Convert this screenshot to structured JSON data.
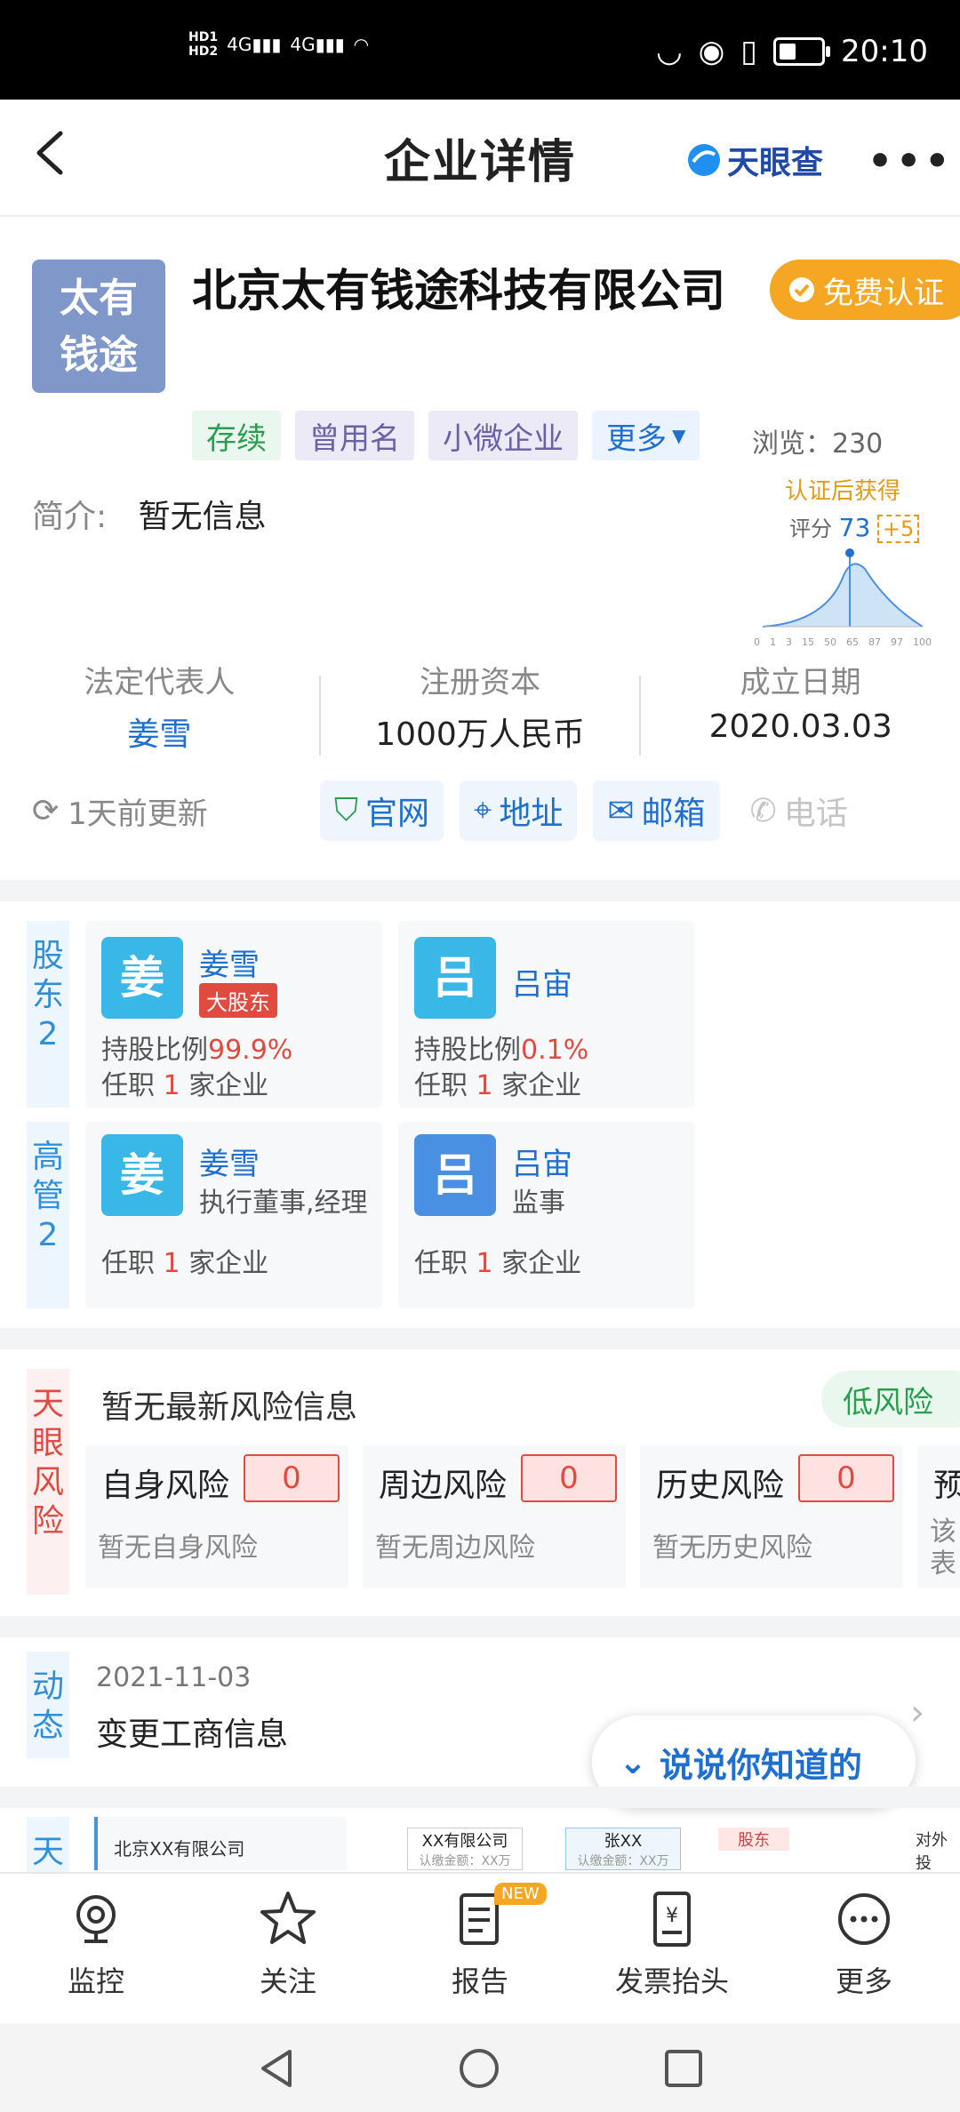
{
  "status_bar": {
    "left_indicators": "HD1 HD2 4G 4G",
    "time": "20:10"
  },
  "titlebar": {
    "title": "企业详情",
    "brand": "天眼查"
  },
  "company": {
    "logo_text_line1": "太有",
    "logo_text_line2": "钱途",
    "name": "北京太有钱途科技有限公司",
    "cert_badge": "免费认证",
    "tags": [
      "存续",
      "曾用名",
      "小微企业",
      "更多"
    ],
    "views_label": "浏览：",
    "views": "230",
    "intro_label": "简介:",
    "intro": "暂无信息",
    "score": {
      "header": "认证后获得",
      "label": "评分",
      "value": "73",
      "bonus": "+5",
      "ticks": [
        "0",
        "1",
        "3",
        "15",
        "50",
        "65",
        "87",
        "97",
        "100"
      ]
    }
  },
  "stats": [
    {
      "label": "法定代表人",
      "value": "姜雪"
    },
    {
      "label": "注册资本",
      "value": "1000万人民币"
    },
    {
      "label": "成立日期",
      "value": "2020.03.03"
    }
  ],
  "update_text": "1天前更新",
  "contacts": [
    "官网",
    "地址",
    "邮箱",
    "电话"
  ],
  "shareholders": {
    "tab": [
      "股",
      "东",
      "2"
    ],
    "items": [
      {
        "avatar": "姜",
        "name": "姜雪",
        "badge": "大股东",
        "ratio_label": "持股比例",
        "ratio": "99.9%",
        "job_prefix": "任职",
        "job_count": "1",
        "job_suffix": "家企业"
      },
      {
        "avatar": "吕",
        "name": "吕宙",
        "ratio_label": "持股比例",
        "ratio": "0.1%",
        "job_prefix": "任职",
        "job_count": "1",
        "job_suffix": "家企业"
      }
    ]
  },
  "executives": {
    "tab": [
      "高",
      "管",
      "2"
    ],
    "items": [
      {
        "avatar": "姜",
        "name": "姜雪",
        "role": "执行董事,经理",
        "job_prefix": "任职",
        "job_count": "1",
        "job_suffix": "家企业"
      },
      {
        "avatar": "吕",
        "name": "吕宙",
        "role": "监事",
        "job_prefix": "任职",
        "job_count": "1",
        "job_suffix": "家企业"
      }
    ]
  },
  "risk": {
    "tab": [
      "天",
      "眼",
      "风",
      "险"
    ],
    "headline": "暂无最新风险信息",
    "level": "低风险",
    "cards": [
      {
        "title": "自身风险",
        "count": "0",
        "sub": "暂无自身风险"
      },
      {
        "title": "周边风险",
        "count": "0",
        "sub": "暂无周边风险"
      },
      {
        "title": "历史风险",
        "count": "0",
        "sub": "暂无历史风险"
      },
      {
        "title": "预",
        "sub1": "该",
        "sub2": "表人"
      }
    ]
  },
  "dynamics": {
    "tab": [
      "动",
      "态"
    ],
    "date": "2021-11-03",
    "text": "变更工商信息",
    "float_button": "说说你知道的"
  },
  "graph_preview": {
    "tab": "天",
    "company": "北京XX有限公司",
    "node1": "XX有限公司",
    "node1_sub": "认缴金额：XX万",
    "node2": "张XX",
    "node2_sub": "认缴金额：XX万",
    "node3": "股东",
    "node4": "对外投"
  },
  "bottom_nav": {
    "items": [
      {
        "icon": "monitor-icon",
        "label": "监控"
      },
      {
        "icon": "star-icon",
        "label": "关注"
      },
      {
        "icon": "report-icon",
        "label": "报告",
        "badge": "NEW"
      },
      {
        "icon": "invoice-icon",
        "label": "发票抬头"
      },
      {
        "icon": "more-icon",
        "label": "更多"
      }
    ]
  }
}
